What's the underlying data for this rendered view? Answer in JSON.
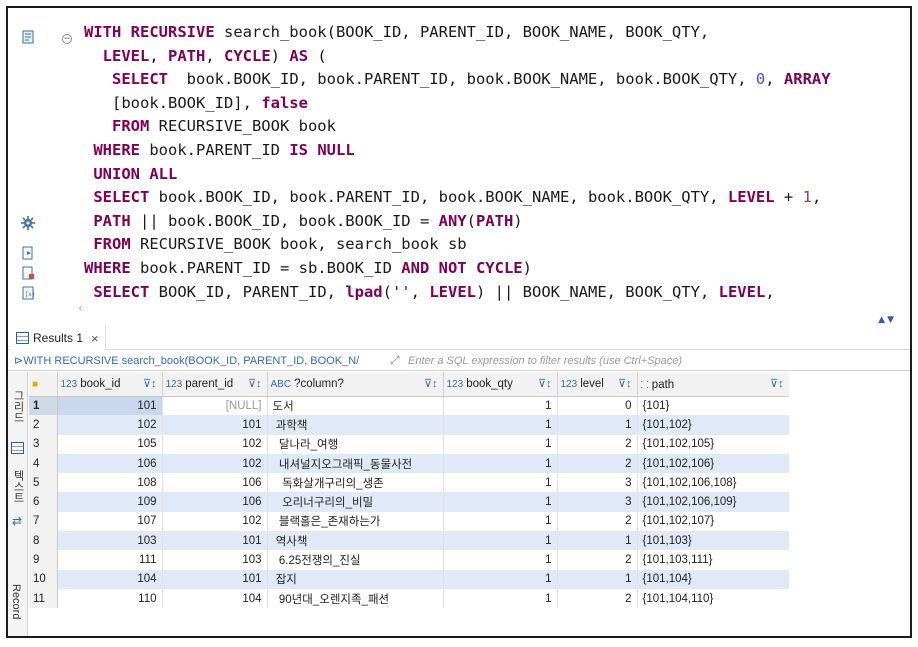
{
  "editor": {
    "lines": [
      [
        {
          "t": "WITH RECURSIVE",
          "k": "kw"
        },
        {
          "t": " search_book(BOOK_ID, PARENT_ID, BOOK_NAME, BOOK_QTY,"
        }
      ],
      [
        {
          "t": "  "
        },
        {
          "t": "LEVEL",
          "k": "kw"
        },
        {
          "t": ", "
        },
        {
          "t": "PATH",
          "k": "kw"
        },
        {
          "t": ", "
        },
        {
          "t": "CYCLE",
          "k": "kw"
        },
        {
          "t": ") "
        },
        {
          "t": "AS",
          "k": "kw"
        },
        {
          "t": " ("
        }
      ],
      [
        {
          "t": "   "
        },
        {
          "t": "SELECT",
          "k": "kw"
        },
        {
          "t": "  book.BOOK_ID, book.PARENT_ID, book.BOOK_NAME, book.BOOK_QTY, "
        },
        {
          "t": "0",
          "k": "num"
        },
        {
          "t": ", "
        },
        {
          "t": "ARRAY",
          "k": "kw"
        }
      ],
      [
        {
          "t": "   [book.BOOK_ID], "
        },
        {
          "t": "false",
          "k": "kw"
        }
      ],
      [
        {
          "t": "   "
        },
        {
          "t": "FROM",
          "k": "kw"
        },
        {
          "t": " RECURSIVE_BOOK book"
        }
      ],
      [
        {
          "t": " "
        },
        {
          "t": "WHERE",
          "k": "kw"
        },
        {
          "t": " book.PARENT_ID "
        },
        {
          "t": "IS NULL",
          "k": "kw"
        }
      ],
      [
        {
          "t": " "
        },
        {
          "t": "UNION ALL",
          "k": "kw"
        }
      ],
      [
        {
          "t": " "
        },
        {
          "t": "SELECT",
          "k": "kw"
        },
        {
          "t": " book.BOOK_ID, book.PARENT_ID, book.BOOK_NAME, book.BOOK_QTY, "
        },
        {
          "t": "LEVEL",
          "k": "kw"
        },
        {
          "t": " + "
        },
        {
          "t": "1",
          "k": "num"
        },
        {
          "t": ","
        }
      ],
      [
        {
          "t": " "
        },
        {
          "t": "PATH",
          "k": "kw"
        },
        {
          "t": " || book.BOOK_ID, book.BOOK_ID = "
        },
        {
          "t": "ANY",
          "k": "kw"
        },
        {
          "t": "("
        },
        {
          "t": "PATH",
          "k": "kw"
        },
        {
          "t": ")"
        }
      ],
      [
        {
          "t": " "
        },
        {
          "t": "FROM",
          "k": "kw"
        },
        {
          "t": " RECURSIVE_BOOK book, search_book sb"
        }
      ],
      [
        {
          "t": "WHERE",
          "k": "kw"
        },
        {
          "t": " book.PARENT_ID = sb.BOOK_ID "
        },
        {
          "t": "AND NOT CYCLE",
          "k": "kw"
        },
        {
          "t": ")"
        }
      ],
      [
        {
          "t": " "
        },
        {
          "t": "SELECT",
          "k": "kw"
        },
        {
          "t": " BOOK_ID, PARENT_ID, "
        },
        {
          "t": "lpad",
          "k": "kw"
        },
        {
          "t": "("
        },
        {
          "t": "''",
          "k": "str"
        },
        {
          "t": ", "
        },
        {
          "t": "LEVEL",
          "k": "kw"
        },
        {
          "t": ") || BOOK_NAME, BOOK_QTY, "
        },
        {
          "t": "LEVEL",
          "k": "kw"
        },
        {
          "t": ","
        }
      ]
    ]
  },
  "results_tab": {
    "label": "Results 1",
    "close": "×"
  },
  "filter": {
    "query": "WITH RECURSIVE search_book(BOOK_ID, PARENT_ID, BOOK_N/",
    "placeholder": "Enter a SQL expression to filter results (use Ctrl+Space)"
  },
  "side_labels": {
    "grid": "그리드",
    "text": "텍스트",
    "record": "Record"
  },
  "columns": [
    {
      "type": "123",
      "name": "book_id"
    },
    {
      "type": "123",
      "name": "parent_id"
    },
    {
      "type": "ABC",
      "name": "?column?"
    },
    {
      "type": "123",
      "name": "book_qty"
    },
    {
      "type": "123",
      "name": "level"
    },
    {
      "type": "⸬",
      "name": "path"
    }
  ],
  "rows": [
    {
      "n": "1",
      "book_id": "101",
      "parent_id": "[NULL]",
      "col": "도서",
      "qty": "1",
      "level": "0",
      "path": "{101}"
    },
    {
      "n": "2",
      "book_id": "102",
      "parent_id": "101",
      "col": " 과학책",
      "qty": "1",
      "level": "1",
      "path": "{101,102}"
    },
    {
      "n": "3",
      "book_id": "105",
      "parent_id": "102",
      "col": "  달나라_여행",
      "qty": "1",
      "level": "2",
      "path": "{101,102,105}"
    },
    {
      "n": "4",
      "book_id": "106",
      "parent_id": "102",
      "col": "  내셔널지오그래픽_동물사전",
      "qty": "1",
      "level": "2",
      "path": "{101,102,106}"
    },
    {
      "n": "5",
      "book_id": "108",
      "parent_id": "106",
      "col": "   독화살개구리의_생존",
      "qty": "1",
      "level": "3",
      "path": "{101,102,106,108}"
    },
    {
      "n": "6",
      "book_id": "109",
      "parent_id": "106",
      "col": "   오리너구리의_비밀",
      "qty": "1",
      "level": "3",
      "path": "{101,102,106,109}"
    },
    {
      "n": "7",
      "book_id": "107",
      "parent_id": "102",
      "col": "  블랙홀은_존재하는가",
      "qty": "1",
      "level": "2",
      "path": "{101,102,107}"
    },
    {
      "n": "8",
      "book_id": "103",
      "parent_id": "101",
      "col": " 역사책",
      "qty": "1",
      "level": "1",
      "path": "{101,103}"
    },
    {
      "n": "9",
      "book_id": "111",
      "parent_id": "103",
      "col": "  6.25전쟁의_진실",
      "qty": "1",
      "level": "2",
      "path": "{101,103,111}"
    },
    {
      "n": "10",
      "book_id": "104",
      "parent_id": "101",
      "col": " 잡지",
      "qty": "1",
      "level": "1",
      "path": "{101,104}"
    },
    {
      "n": "11",
      "book_id": "110",
      "parent_id": "104",
      "col": "  90년대_오렌지족_패션",
      "qty": "1",
      "level": "2",
      "path": "{101,104,110}"
    }
  ]
}
